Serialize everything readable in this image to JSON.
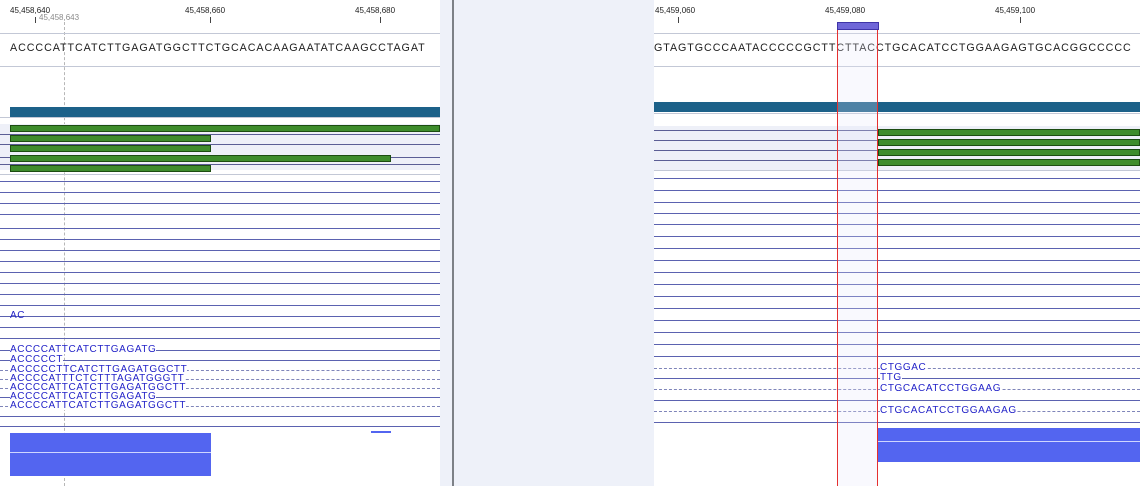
{
  "left_panel": {
    "ruler": {
      "ticks": [
        "45,458,640",
        "45,458,660",
        "45,458,680"
      ],
      "cursor_position": "45,458,643"
    },
    "reference_sequence": "ACCCCATTCATCTTGAGATGGCTTCTGCACACAAGAATATCAAGCCTAGAT",
    "reads": [
      {
        "text": "AC",
        "style": "solid"
      },
      {
        "text": "ACCCCATTCATCTTGAGATG",
        "style": "solid"
      },
      {
        "text": "ACCCCCT",
        "style": "solid"
      },
      {
        "text": "ACCCCCTTCATCTTGAGATGGCTT",
        "style": "dashed"
      },
      {
        "text": "ACCCCATTTCTCTTTAGATGGGTT",
        "style": "dashed"
      },
      {
        "text": "ACCCCATTCATCTTGAGATGGCTT",
        "style": "dashed"
      },
      {
        "text": "ACCCCATTCATCTTGAGATG",
        "style": "solid"
      },
      {
        "text": "ACCCCATTCATCTTGAGATGGCTT",
        "style": "dashed"
      }
    ]
  },
  "right_panel": {
    "ruler": {
      "ticks": [
        "45,459,060",
        "45,459,080",
        "45,459,100"
      ]
    },
    "reference_sequence": "GTAGTGCCCAATACCCCCGCTTCTTACCTGCACATCCTGGAAGAGTGCACGGCCCCC",
    "reads": [
      {
        "text": "CTGGAC",
        "style": "solid"
      },
      {
        "text": "TTG",
        "style": "solid"
      },
      {
        "text": "CTGCACATCCTGGAAG",
        "style": "solid"
      },
      {
        "text": "CTGCACATCCTGGAAGAG",
        "style": "solid"
      }
    ]
  },
  "colors": {
    "gene_bar": "#1c6189",
    "read_green": "#3e8c2c",
    "read_text": "#2323c8",
    "selection_border": "#e53030",
    "coverage": "#5365f0",
    "mismatch_highlight": "#ffe95a"
  }
}
